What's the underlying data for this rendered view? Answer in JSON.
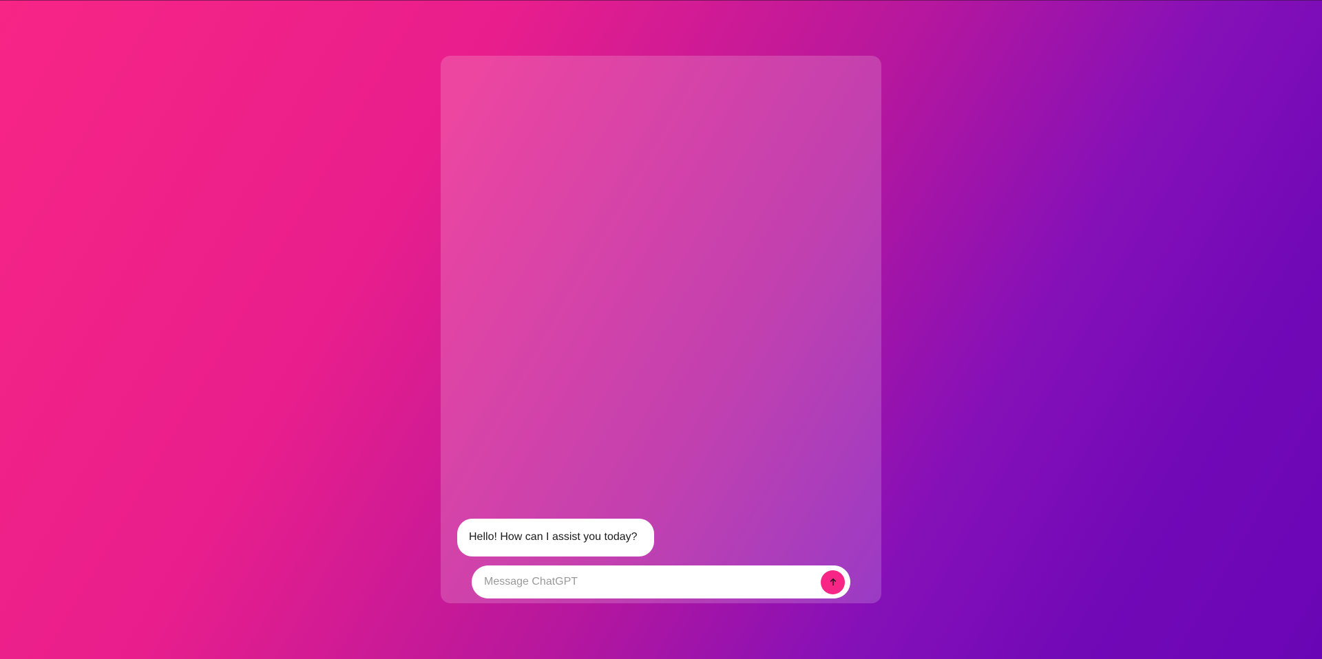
{
  "chat": {
    "messages": [
      {
        "sender": "assistant",
        "text": "Hello! How can I assist you today?"
      }
    ],
    "input": {
      "placeholder": "Message ChatGPT",
      "value": ""
    },
    "send_button": {
      "icon": "arrow-up-icon"
    }
  },
  "colors": {
    "accent": "#f72585",
    "background_start": "#f72585",
    "background_end": "#7209b7"
  }
}
